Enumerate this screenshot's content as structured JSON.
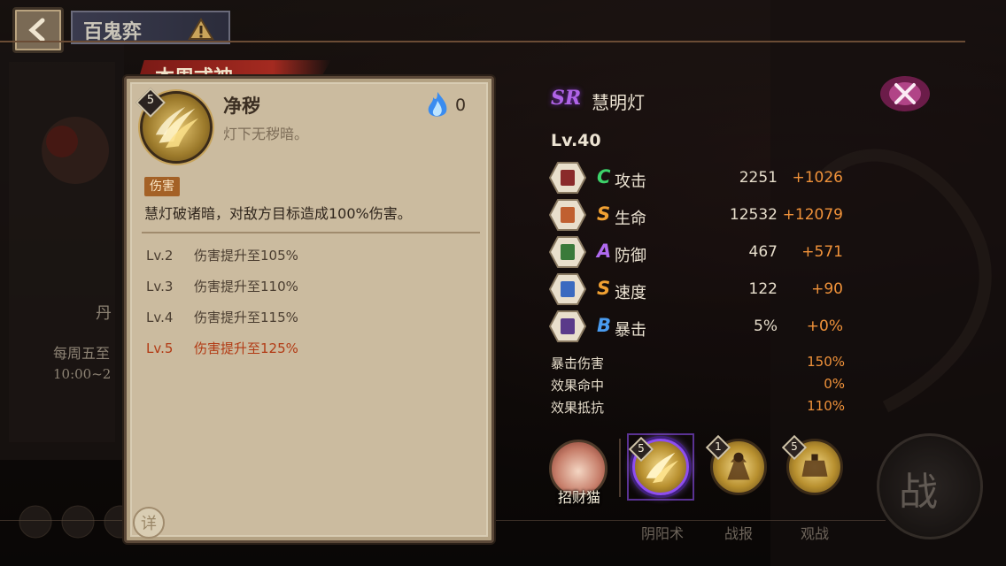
{
  "topbar": {
    "title": "百鬼弈"
  },
  "background": {
    "left_partial_1": "丹",
    "left_partial_2": "每周五至",
    "left_partial_3": "10:00~2",
    "bottom_menu": [
      "阴阳术",
      "战报",
      "观战"
    ],
    "battle_label": "战"
  },
  "card": {
    "tab_label": "本周式神",
    "level": "5",
    "skill_name": "净秽",
    "skill_desc": "灯下无秽暗。",
    "fire_cost": "0",
    "tag": "伤害",
    "effect": "慧灯破诸暗，对敌方目标造成100%伤害。",
    "levels": [
      {
        "lv": "Lv.2",
        "text": "伤害提升至105%"
      },
      {
        "lv": "Lv.3",
        "text": "伤害提升至110%"
      },
      {
        "lv": "Lv.4",
        "text": "伤害提升至115%"
      },
      {
        "lv": "Lv.5",
        "text": "伤害提升至125%"
      }
    ],
    "detail_label": "详"
  },
  "shikigami": {
    "rarity": "SR",
    "name": "慧明灯",
    "level": "Lv.40",
    "stats": [
      {
        "grade": "C",
        "name": "攻击",
        "base": "2251",
        "bonus": "+1026",
        "grade_color": "#3dd26a",
        "icon": "attack-icon"
      },
      {
        "grade": "S",
        "name": "生命",
        "base": "12532",
        "bonus": "+12079",
        "grade_color": "#f0a032",
        "icon": "health-icon"
      },
      {
        "grade": "A",
        "name": "防御",
        "base": "467",
        "bonus": "+571",
        "grade_color": "#b06af0",
        "icon": "defense-icon"
      },
      {
        "grade": "S",
        "name": "速度",
        "base": "122",
        "bonus": "+90",
        "grade_color": "#f0a032",
        "icon": "speed-icon"
      },
      {
        "grade": "B",
        "name": "暴击",
        "base": "5%",
        "bonus": "+0%",
        "grade_color": "#4a9cf0",
        "icon": "crit-icon"
      }
    ],
    "sub_stats": [
      {
        "name": "暴击伤害",
        "value": "150%"
      },
      {
        "name": "效果命中",
        "value": "0%"
      },
      {
        "name": "效果抵抗",
        "value": "110%"
      }
    ]
  },
  "skills_bar": {
    "avatar_name": "招财猫",
    "slots": [
      {
        "level": "5",
        "selected": true
      },
      {
        "level": "1",
        "selected": false
      },
      {
        "level": "5",
        "selected": false
      }
    ]
  }
}
